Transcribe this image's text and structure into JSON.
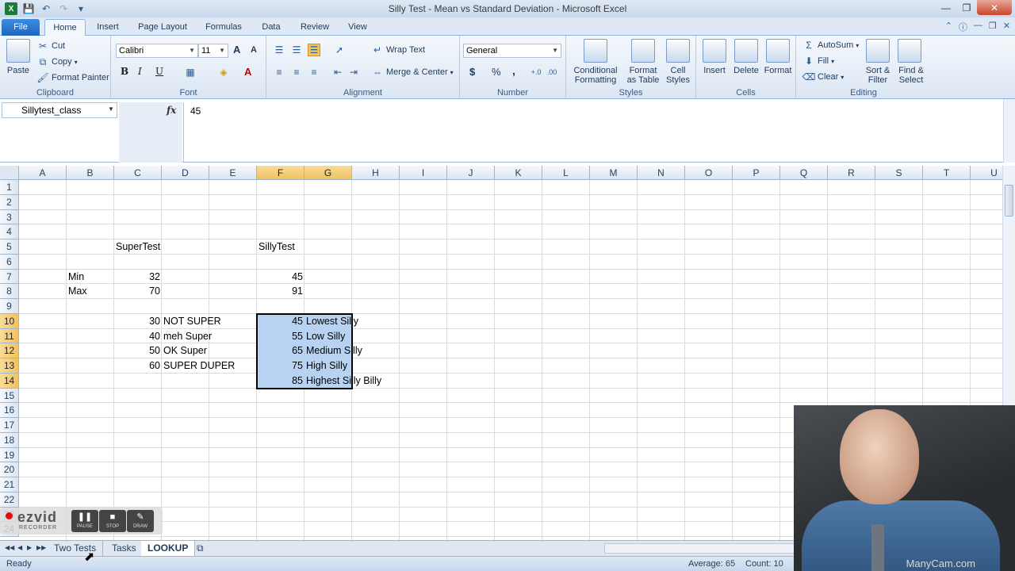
{
  "window": {
    "title": "Silly Test - Mean vs Standard Deviation - Microsoft Excel"
  },
  "tabs": [
    "File",
    "Home",
    "Insert",
    "Page Layout",
    "Formulas",
    "Data",
    "Review",
    "View"
  ],
  "ribbon": {
    "clipboard": {
      "label": "Clipboard",
      "paste": "Paste",
      "cut": "Cut",
      "copy": "Copy",
      "format_painter": "Format Painter"
    },
    "font": {
      "label": "Font",
      "name": "Calibri",
      "size": "11",
      "bold": "B",
      "italic": "I",
      "underline": "U",
      "grow": "A",
      "shrink": "A",
      "color": "A"
    },
    "alignment": {
      "label": "Alignment",
      "wrap_text": "Wrap Text",
      "merge_center": "Merge & Center"
    },
    "number": {
      "label": "Number",
      "format": "General",
      "currency": "$",
      "percent": "%",
      "comma": ","
    },
    "styles": {
      "label": "Styles",
      "conditional_1": "Conditional",
      "conditional_2": "Formatting",
      "format_table_1": "Format",
      "format_table_2": "as Table",
      "cell_styles_1": "Cell",
      "cell_styles_2": "Styles"
    },
    "cells": {
      "label": "Cells",
      "insert": "Insert",
      "delete": "Delete",
      "format": "Format"
    },
    "editing": {
      "label": "Editing",
      "autosum": "AutoSum",
      "fill": "Fill",
      "clear": "Clear",
      "sort_1": "Sort &",
      "sort_2": "Filter",
      "find_1": "Find &",
      "find_2": "Select"
    }
  },
  "formula_bar": {
    "name_box": "Sillytest_class",
    "fx": "fx",
    "value": "45"
  },
  "columns": [
    "A",
    "B",
    "C",
    "D",
    "E",
    "F",
    "G",
    "H",
    "I",
    "J",
    "K",
    "L",
    "M",
    "N",
    "O",
    "P",
    "Q",
    "R",
    "S",
    "T",
    "U"
  ],
  "rows": [
    "1",
    "2",
    "3",
    "4",
    "5",
    "6",
    "7",
    "8",
    "9",
    "10",
    "11",
    "12",
    "13",
    "14",
    "15",
    "16",
    "17",
    "18",
    "19",
    "20",
    "21",
    "22",
    "23",
    "24"
  ],
  "cells": {
    "C5": "SuperTest",
    "F5": "SillyTest",
    "B7": "Min",
    "C7": "32",
    "F7": "45",
    "B8": "Max",
    "C8": "70",
    "F8": "91",
    "C10": "30",
    "D10": "NOT SUPER",
    "F10": "45",
    "G10": "Lowest Silly",
    "C11": "40",
    "D11": "meh Super",
    "F11": "55",
    "G11": "Low Silly",
    "C12": "50",
    "D12": "OK Super",
    "F12": "65",
    "G12": "Medium Silly",
    "C13": "60",
    "D13": "SUPER DUPER",
    "F13": "75",
    "G13": "High Silly",
    "F14": "85",
    "G14": "Highest Silly Billy"
  },
  "sheet_tabs": [
    "Two Tests",
    "Tasks",
    "LOOKUP"
  ],
  "active_sheet": "LOOKUP",
  "status": {
    "ready": "Ready",
    "average": "Average: 65",
    "count": "Count: 10"
  },
  "recorder": {
    "brand": "ezvid",
    "sub": "RECORDER",
    "pause": "PAUSE",
    "stop": "STOP",
    "draw": "DRAW"
  },
  "webcam": {
    "watermark": "ManyCam.com"
  },
  "colors": {
    "selection": "#b8d3f1",
    "header_selected": "#f1c15f",
    "ribbon_accent": "#1f66c2"
  }
}
